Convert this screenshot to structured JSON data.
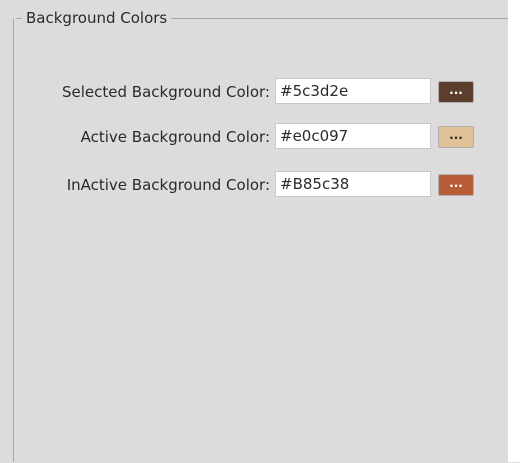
{
  "group": {
    "title": "Background Colors"
  },
  "rows": [
    {
      "label": "Selected Background Color:",
      "value": "#5c3d2e",
      "button_label": "...",
      "swatch_color": "#5c3d2e",
      "text_color": "#ffffff"
    },
    {
      "label": "Active Background Color:",
      "value": "#e0c097",
      "button_label": "...",
      "swatch_color": "#e0c097",
      "text_color": "#2a2a2a"
    },
    {
      "label": "InActive Background Color:",
      "value": "#B85c38",
      "button_label": "...",
      "swatch_color": "#B85c38",
      "text_color": "#ffffff"
    }
  ]
}
